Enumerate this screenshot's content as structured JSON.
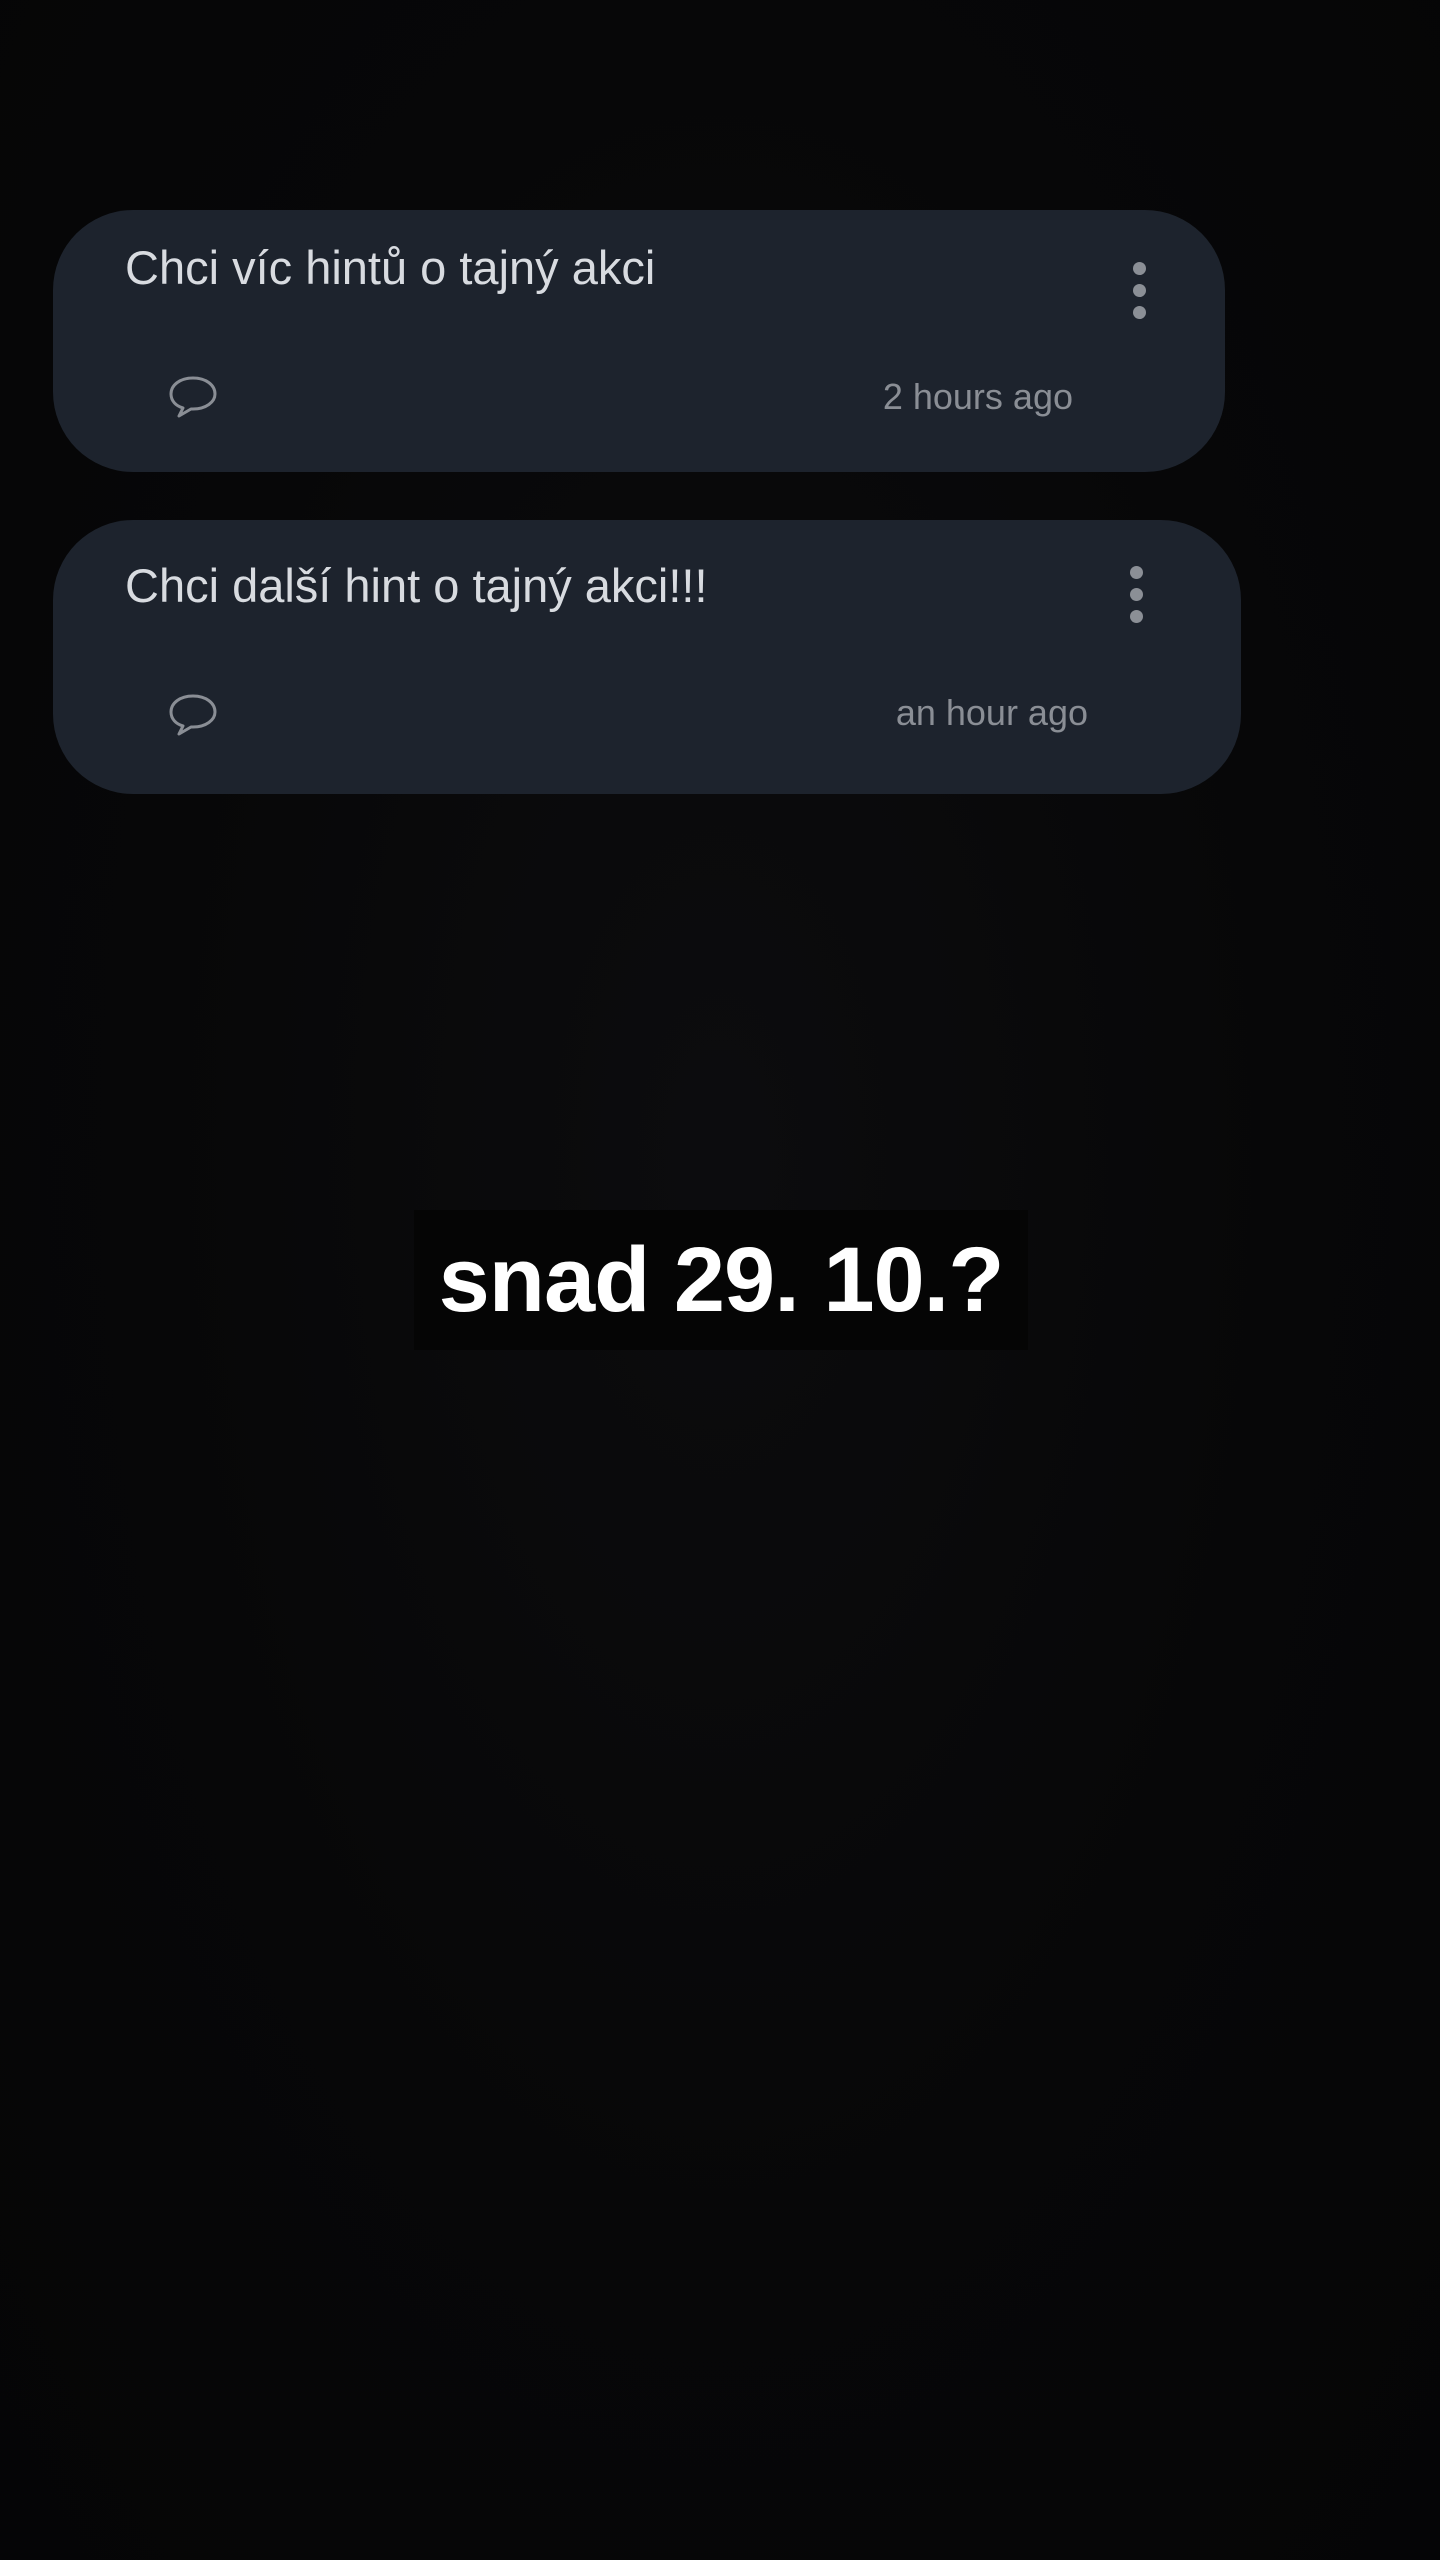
{
  "posts": [
    {
      "title": "Chci víc hintů o tajný akci",
      "time": "2 hours ago",
      "comment_icon": "speech-bubble-icon",
      "menu_icon": "more-vertical-icon"
    },
    {
      "title": "Chci další hint o tajný akci!!!",
      "time": "an hour ago",
      "comment_icon": "speech-bubble-icon",
      "menu_icon": "more-vertical-icon"
    }
  ],
  "caption": {
    "text": "snad 29. 10.?"
  },
  "colors": {
    "background": "#060607",
    "card": "#1d232d",
    "title": "#d8dbe0",
    "muted": "#8a8e95",
    "caption": "#ffffff"
  }
}
